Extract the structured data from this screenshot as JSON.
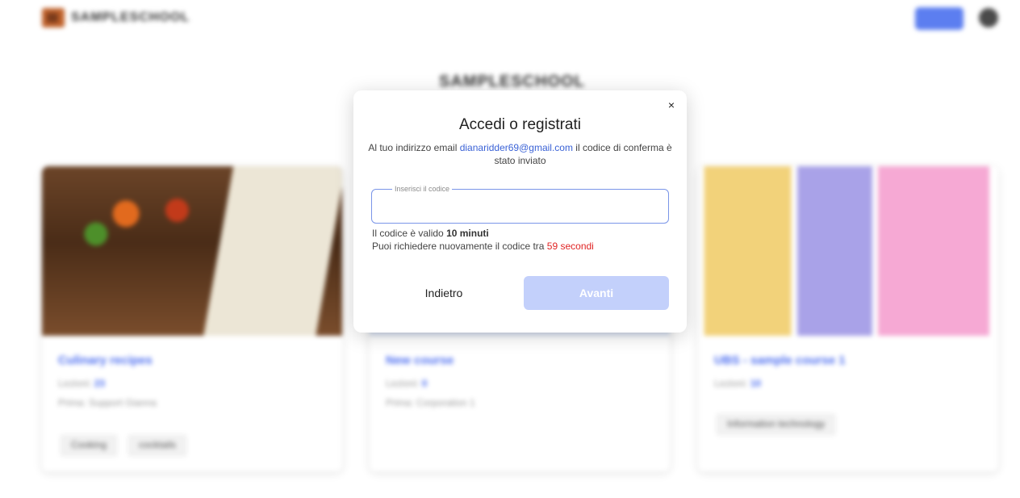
{
  "background": {
    "brand_name": "SAMPLESCHOOL",
    "school_title": "SAMPLESCHOOL",
    "cards": [
      {
        "title": "Culinary recipes",
        "meta1_label": "Lezioni:",
        "meta1_value": "23",
        "meta2_label": "Prima:",
        "meta2_value": "Support Gianna",
        "tags": [
          "Cooking",
          "cocktails"
        ]
      },
      {
        "title": "New course",
        "meta1_label": "Lezioni:",
        "meta1_value": "0",
        "meta2_label": "Prima:",
        "meta2_value": "Corporation 1",
        "tags": []
      },
      {
        "title": "UBS - sample course 1",
        "meta1_label": "Lezioni:",
        "meta1_value": "10",
        "meta2_label": "",
        "meta2_value": "",
        "tags": [
          "Information technology"
        ]
      }
    ]
  },
  "modal": {
    "title": "Accedi o registrati",
    "desc_before": "Al tuo indirizzo email ",
    "email": "dianaridder69@gmail.com",
    "desc_after": " il codice di conferma è stato inviato",
    "code_label": "Inserisci il codice",
    "code_value": "",
    "valid_prefix": "Il codice è valido ",
    "valid_duration": "10 minuti",
    "resend_prefix": "Puoi richiedere nuovamente il codice tra ",
    "resend_countdown": "59 secondi",
    "back_label": "Indietro",
    "next_label": "Avanti",
    "close_glyph": "×"
  },
  "colors": {
    "accent": "#3a62d6",
    "next_disabled": "#c3d0fb",
    "countdown": "#e02424"
  }
}
